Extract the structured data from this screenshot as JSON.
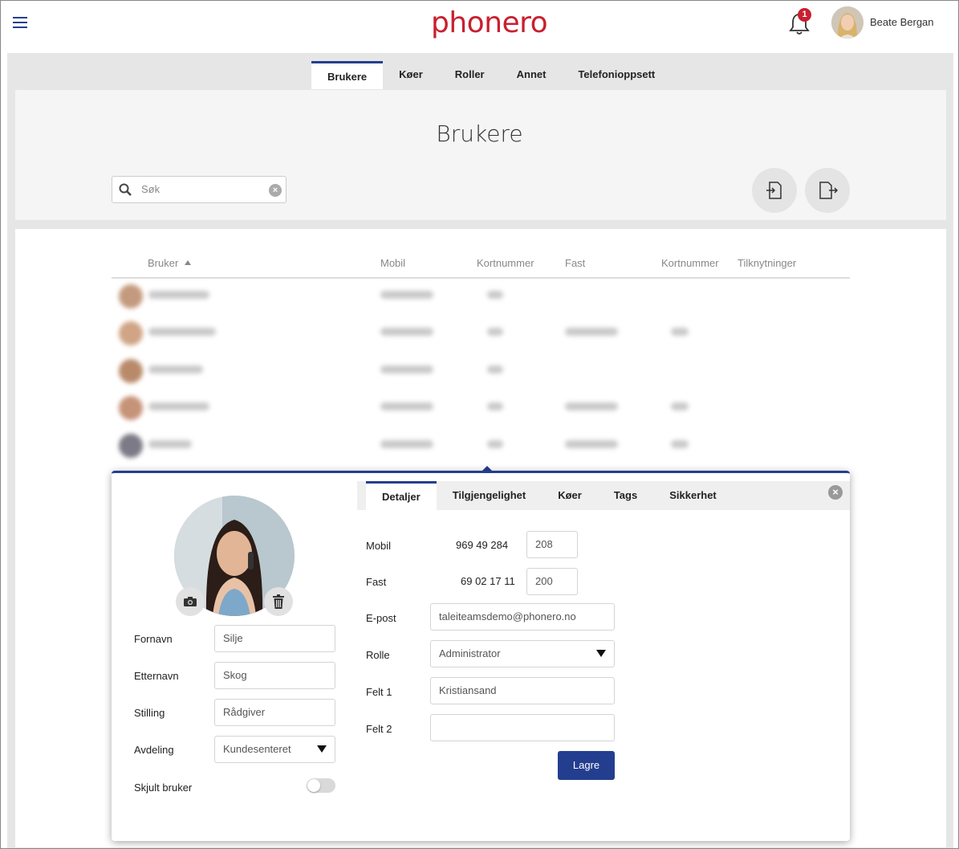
{
  "header": {
    "logo": "phonero",
    "notification_count": "1",
    "user_name": "Beate Bergan"
  },
  "top_tabs": [
    {
      "label": "Brukere",
      "active": true
    },
    {
      "label": "Køer"
    },
    {
      "label": "Roller"
    },
    {
      "label": "Annet"
    },
    {
      "label": "Telefonioppsett"
    }
  ],
  "page": {
    "title": "Brukere",
    "search_placeholder": "Søk"
  },
  "table": {
    "columns": [
      "Bruker",
      "Mobil",
      "Kortnummer",
      "Fast",
      "Kortnummer",
      "Tilknytninger"
    ],
    "sort_column": "Bruker",
    "sort_direction": "ascending"
  },
  "detail": {
    "tabs": [
      {
        "label": "Detaljer",
        "active": true
      },
      {
        "label": "Tilgjengelighet"
      },
      {
        "label": "Køer"
      },
      {
        "label": "Tags"
      },
      {
        "label": "Sikkerhet"
      }
    ],
    "left": {
      "first_name_label": "Fornavn",
      "first_name": "Silje",
      "last_name_label": "Etternavn",
      "last_name": "Skog",
      "title_label": "Stilling",
      "title": "Rådgiver",
      "department_label": "Avdeling",
      "department": "Kundesenteret",
      "hide_label": "Skjult bruker",
      "hide_user": false
    },
    "right": {
      "mobile_label": "Mobil",
      "mobile": "969 49 284",
      "mobile_short": "208",
      "fixed_label": "Fast",
      "fixed": "69 02 17 11",
      "fixed_short": "200",
      "email_label": "E-post",
      "email": "taleiteamsdemo@phonero.no",
      "role_label": "Rolle",
      "role": "Administrator",
      "field1_label": "Felt 1",
      "field1": "Kristiansand",
      "field2_label": "Felt 2",
      "field2": "",
      "save_label": "Lagre"
    }
  },
  "colors": {
    "brand_red": "#c8202f",
    "accent_blue": "#243e8f"
  }
}
